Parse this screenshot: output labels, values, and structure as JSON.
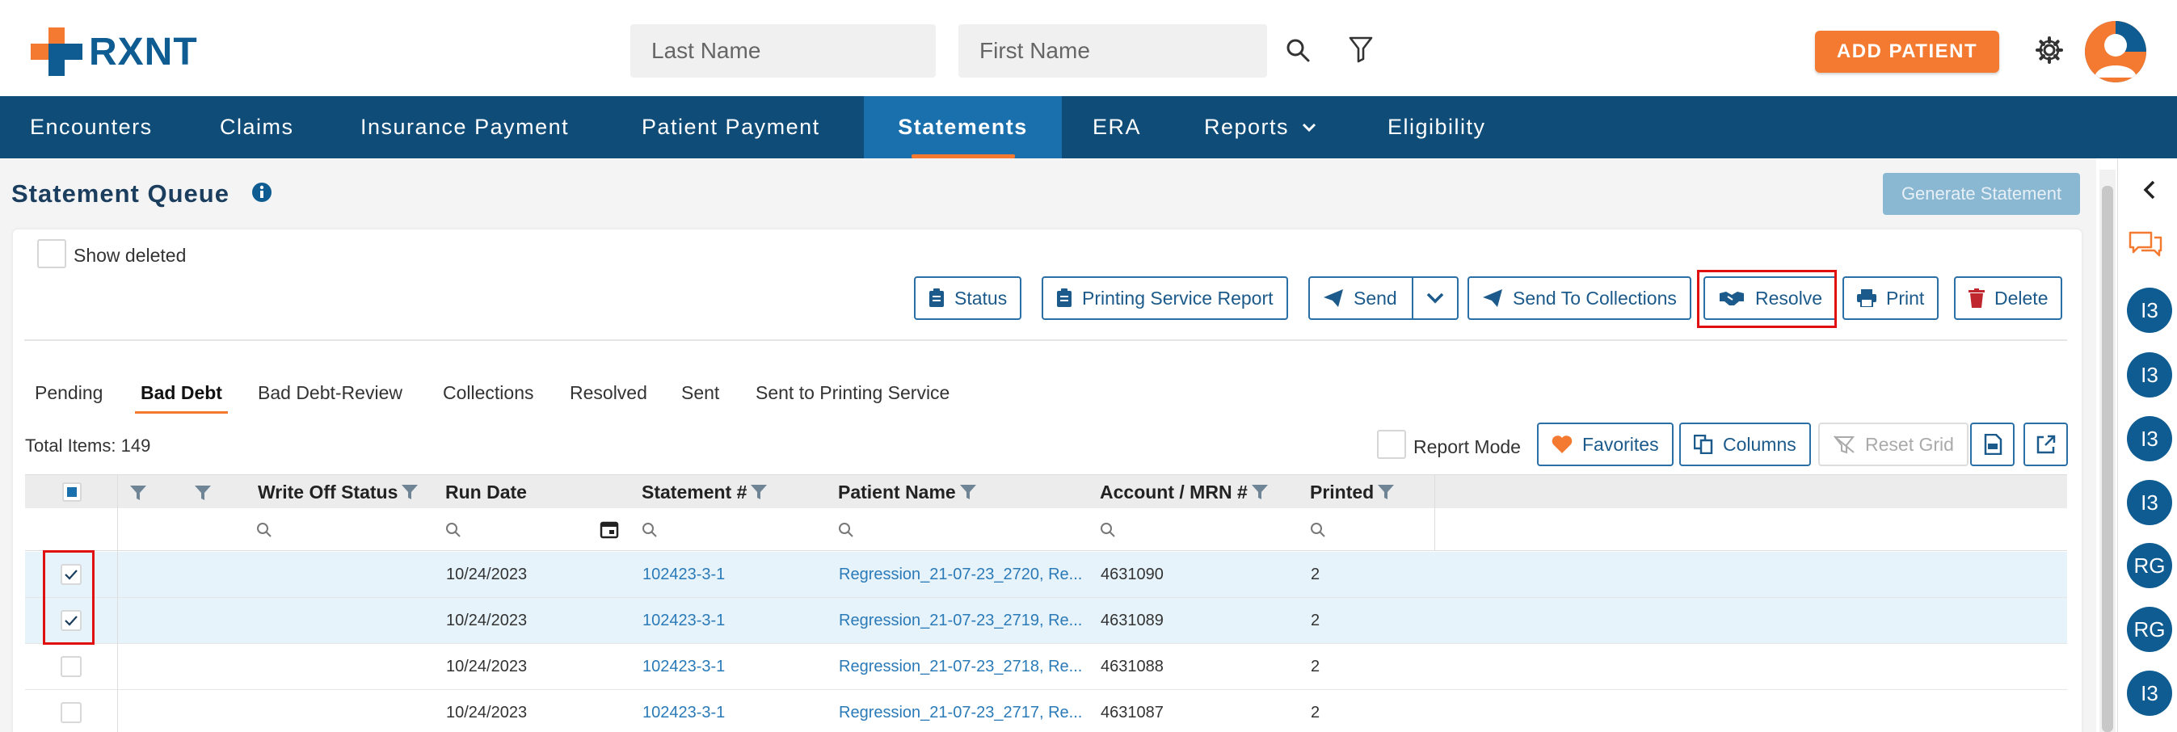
{
  "app": {
    "logo_text": "RXNT"
  },
  "header": {
    "last_name_placeholder": "Last Name",
    "first_name_placeholder": "First Name",
    "add_patient_label": "ADD PATIENT"
  },
  "nav": {
    "items": [
      "Encounters",
      "Claims",
      "Insurance Payment",
      "Patient Payment",
      "Statements",
      "ERA",
      "Reports",
      "Eligibility"
    ],
    "active": "Statements"
  },
  "page": {
    "title": "Statement Queue",
    "generate_label": "Generate Statement",
    "show_deleted_label": "Show deleted"
  },
  "toolbar": {
    "status": "Status",
    "printing_report": "Printing Service Report",
    "send": "Send",
    "send_collections": "Send To Collections",
    "resolve": "Resolve",
    "print": "Print",
    "delete": "Delete"
  },
  "tabs": [
    "Pending",
    "Bad Debt",
    "Bad Debt-Review",
    "Collections",
    "Resolved",
    "Sent",
    "Sent to Printing Service"
  ],
  "active_tab": "Bad Debt",
  "grid_toolbar": {
    "total_items": "Total Items: 149",
    "report_mode": "Report Mode",
    "favorites": "Favorites",
    "columns": "Columns",
    "reset_grid": "Reset Grid"
  },
  "table": {
    "columns": [
      "Write Off Status",
      "Run Date",
      "Statement #",
      "Patient Name",
      "Account / MRN #",
      "Printed"
    ],
    "rows": [
      {
        "selected": true,
        "run_date": "10/24/2023",
        "statement": "102423-3-1",
        "patient": "Regression_21-07-23_2720, Re...",
        "account": "4631090",
        "printed": "2"
      },
      {
        "selected": true,
        "run_date": "10/24/2023",
        "statement": "102423-3-1",
        "patient": "Regression_21-07-23_2719, Re...",
        "account": "4631089",
        "printed": "2"
      },
      {
        "selected": false,
        "run_date": "10/24/2023",
        "statement": "102423-3-1",
        "patient": "Regression_21-07-23_2718, Re...",
        "account": "4631088",
        "printed": "2"
      },
      {
        "selected": false,
        "run_date": "10/24/2023",
        "statement": "102423-3-1",
        "patient": "Regression_21-07-23_2717, Re...",
        "account": "4631087",
        "printed": "2"
      }
    ]
  },
  "rail": {
    "badges": [
      "I3",
      "I3",
      "I3",
      "I3",
      "RG",
      "RG",
      "I3"
    ]
  },
  "colors": {
    "brand_blue": "#0e5c91",
    "nav_blue": "#0f4c78",
    "accent_orange": "#f47a32",
    "highlight_red": "#e01010"
  }
}
